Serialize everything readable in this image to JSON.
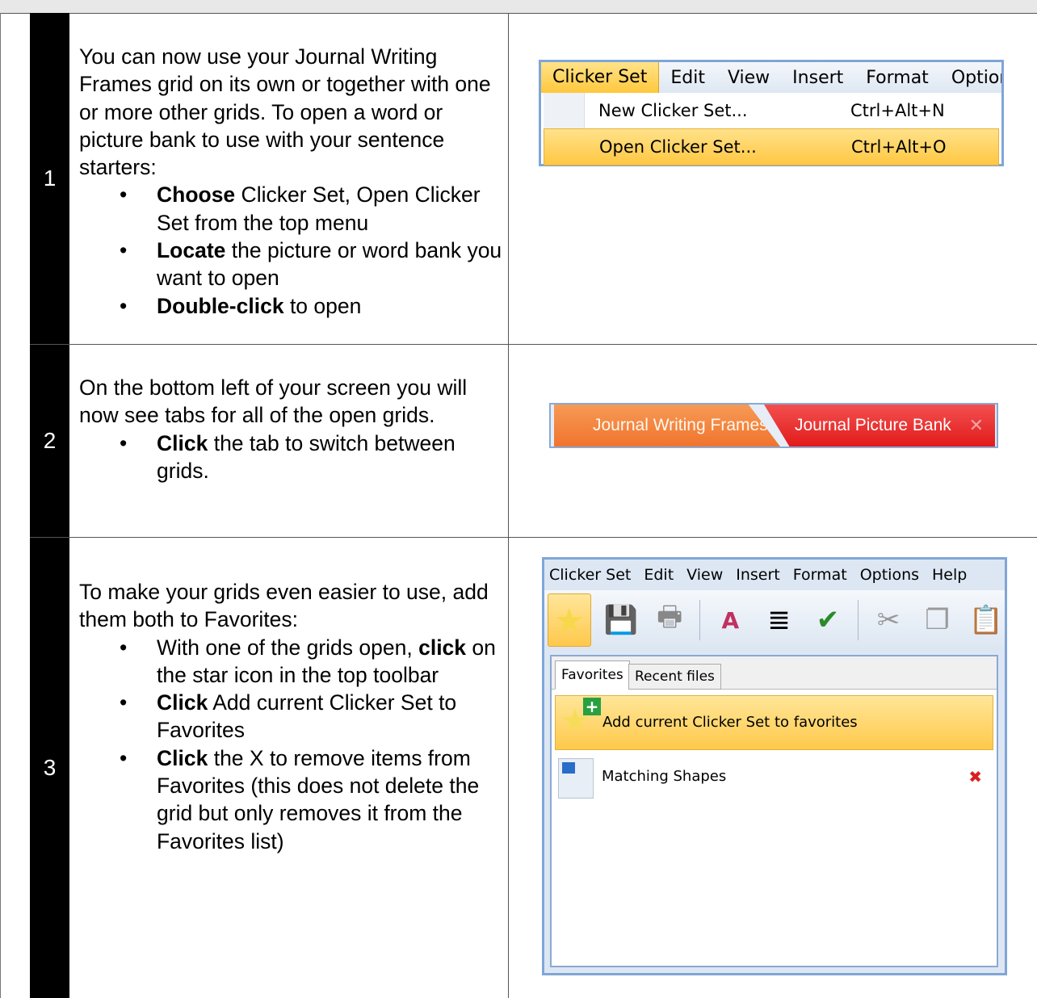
{
  "rows": [
    {
      "number": "1",
      "intro": "You can now use your Journal Writing Frames grid on its own or together with one or more other grids.  To open a word or picture bank to use with your sentence starters:",
      "bullets": [
        {
          "bold": "Choose",
          "rest": " Clicker Set, Open Clicker Set from the top menu"
        },
        {
          "bold": "Locate",
          "rest": " the picture or word bank you want to open"
        },
        {
          "bold": "Double-click",
          "rest": " to open"
        }
      ]
    },
    {
      "number": "2",
      "intro": "On the bottom left of your screen you will now see tabs for all of the open grids.",
      "bullets": [
        {
          "bold": "Click",
          "rest": " the tab to switch between grids."
        }
      ]
    },
    {
      "number": "3",
      "intro": "To make your grids even easier to use, add them both to Favorites:",
      "bullets": [
        {
          "bold": "",
          "pre": "With one of the grids open, ",
          "bold2": "click",
          "rest": " on the star icon in the top toolbar"
        },
        {
          "bold": "Click",
          "rest": " Add current Clicker Set to Favorites"
        },
        {
          "bold": "Click",
          "rest": " the X to remove items from Favorites (this does not delete the grid but only removes it from the Favorites list)"
        }
      ]
    }
  ],
  "menu1": {
    "bar": [
      "Clicker Set",
      "Edit",
      "View",
      "Insert",
      "Format",
      "Options"
    ],
    "items": [
      {
        "label": "New Clicker Set...",
        "key": "Ctrl+Alt+N"
      },
      {
        "label": "Open Clicker Set...",
        "key": "Ctrl+Alt+O"
      }
    ]
  },
  "tabs2": {
    "tab1": "Journal Writing Frames",
    "tab2": "Journal Picture Bank",
    "close": "✕"
  },
  "win3": {
    "bar": [
      "Clicker Set",
      "Edit",
      "View",
      "Insert",
      "Format",
      "Options",
      "Help"
    ],
    "tab_favorites": "Favorites",
    "tab_recent": "Recent files",
    "add_label": "Add current Clicker Set to favorites",
    "fav_item": "Matching Shapes",
    "remove": "✖",
    "icons": [
      "star-icon",
      "save-icon",
      "print-icon",
      "spelling-icon",
      "list-icon",
      "spellcheck-icon",
      "cut-icon",
      "copy-icon",
      "paste-icon"
    ]
  },
  "colors": {
    "accent_orange": "#f0742e",
    "accent_red": "#e21a1a",
    "highlight": "#ffc742",
    "frame_blue": "#7fa6d6"
  }
}
